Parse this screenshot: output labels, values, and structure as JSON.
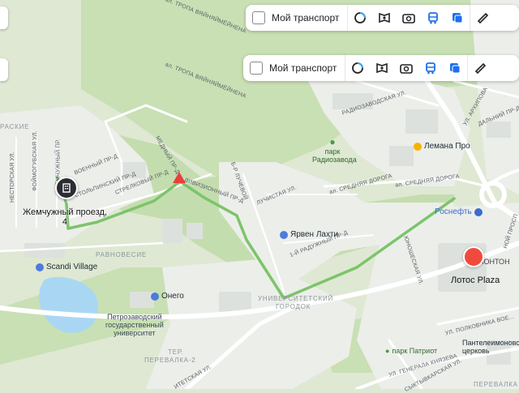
{
  "toolbar_ghost": {
    "transport_label": "Мой транспорт"
  },
  "toolbar": {
    "transport_label": "Мой транспорт",
    "icons": [
      "map-layers-icon",
      "panorama-icon",
      "photo-icon",
      "transit-icon",
      "layers-icon",
      "ruler-icon"
    ]
  },
  "marker": {
    "address_line1": "Жемчужный проезд,",
    "address_line2": "4"
  },
  "streets": {
    "tropa_top": "ал. ТРОПА ВЯЙНЯЙМЁЙНЕНА",
    "tropa_mid": "ал. ТРОПА ВЯЙНЯЙМЁЙНЕНА",
    "radiozavod": "РАДИОЗАВОДСКАЯ УЛ.",
    "foymolskaya": "ФОЙМОГУБСКАЯ УЛ.",
    "nestorskaya": "НЕСТОРСКАЯ УЛ.",
    "zhemchuzhny": "ЖЕМЧУЖНЫЙ ПР.",
    "voenny": "ВОЕННЫЙ ПР-Д",
    "stolypinsky": "СТОЛЬПИНСКИЙ ПР-Д",
    "strelkovy": "СТРЕЛКОВЫЙ ПР-Д",
    "divizionny": "ДИВИЗИОННЫЙ ПР-Д",
    "mednyy": "МЕДНЫЙ ПР-Д",
    "luchevoy": "Б-Р ЛУЧЕВОЙ",
    "luchistaya": "ЛУЧИСТАЯ УЛ.",
    "sredn_1": "ал. СРЕДНЯЯ ДОРОГА",
    "sredn_2": "ал. СРЕДНЯЯ ДОРОГА",
    "raduzhny": "1-Й РАДУЖНЫЙ ПР-Д",
    "yunosheskaya": "ЮНОШЕСКАЯ УЛ.",
    "dalny": "ДАЛЬНИЙ ПР-Д",
    "arkhipova": "УЛ. АРХИПОВА",
    "polkovnika": "УЛ. ПОЛКОВНИКА ВОЕ...",
    "generala": "УЛ. ГЕНЕРАЛА КНЯЗЕВА",
    "syktyvkarskaya": "СЫКТЫВКАРСКАЯ УЛ.",
    "universitetskaya": "ИТЕТСКАЯ УЛ.",
    "nordp": "НОЙ ПРОСП"
  },
  "districts": {
    "raskie": "РАСКИЕ",
    "ravnovesie": "РАВНОВЕСИЕ",
    "universitet": "УНИВЕРСИТЕТСКИЙ",
    "gorodok": "ГОРОДОК",
    "ter1": "ТЕР.",
    "ter2": "ПЕРЕВАЛКА-2",
    "perevalka": "ПЕРЕВАЛКА"
  },
  "pois": {
    "park_radiozavoda_1": "парк",
    "park_radiozavoda_2": "Радиозавода",
    "lemana": "Лемана Про",
    "rosneft": "Роснефть",
    "yarven": "Ярвен Лахти",
    "scandi": "Scandi Village",
    "onego": "Онего",
    "univ_1": "Петрозаводский",
    "univ_2": "государственный",
    "univ_3": "университет",
    "ponton": "ПОНТОН",
    "lotos": "Лотос Plaza",
    "park_patriot": "парк Патриот",
    "panteleimon_1": "Пантелеимоновская",
    "panteleimon_2": "церковь"
  },
  "colors": {
    "forest": "#c8e0b4",
    "urban": "#eef0ee",
    "road": "#ffffff",
    "route": "#7cc46a",
    "water": "#a9d7f3",
    "poi_blue": "#4c7bdc",
    "marker": "#2a2d33",
    "poi_red": "#f04a3e"
  }
}
